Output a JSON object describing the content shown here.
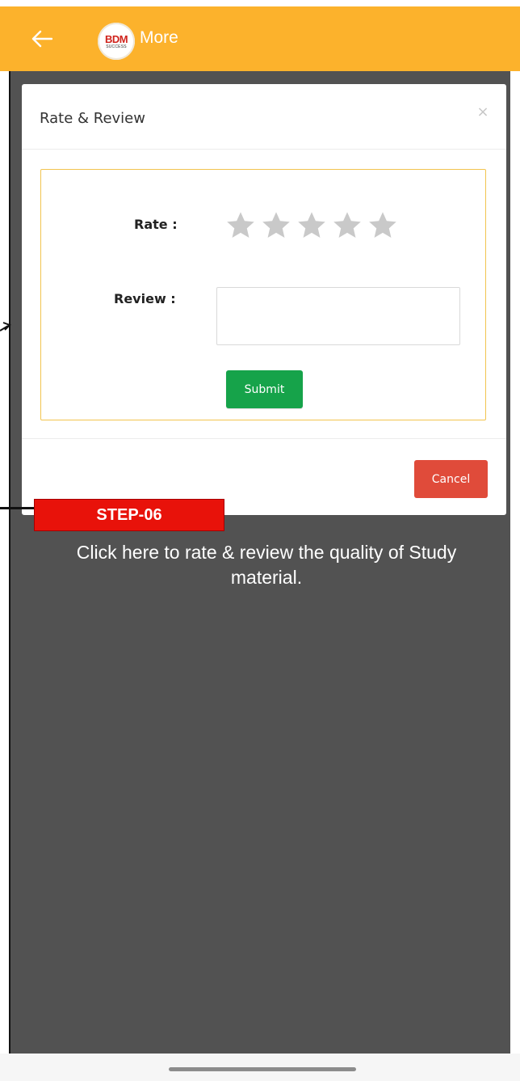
{
  "app_bar": {
    "title": "More",
    "background_color": "#fcb22c",
    "back_icon": "arrow-left-icon",
    "logo_text": "BDM",
    "logo_subtext": "SUCCESS"
  },
  "modal": {
    "title": "Rate & Review",
    "close_label": "×",
    "rate_label": "Rate :",
    "review_label": "Review :",
    "rating": {
      "value": 0,
      "max": 5,
      "icon": "star-icon",
      "empty_color": "#c9c9c9"
    },
    "review_value": "",
    "submit_label": "Submit",
    "submit_color": "#16a34a",
    "cancel_label": "Cancel",
    "cancel_color": "#e04b3a",
    "form_border_color": "#f2c44f"
  },
  "annotation": {
    "step_label": "STEP-06",
    "caption": "Click here to rate & review the quality of Study material.",
    "badge_color": "#e8120a"
  }
}
